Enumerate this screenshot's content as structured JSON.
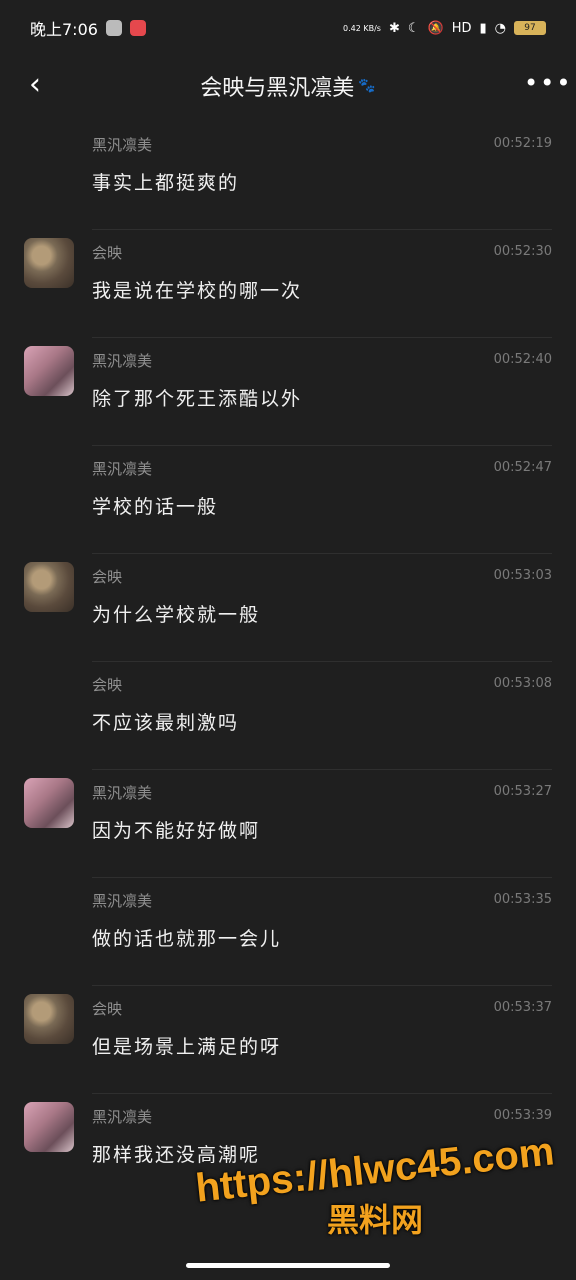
{
  "status": {
    "time": "晚上7:06",
    "net_speed": "0.42\nKB/s",
    "network": "HD",
    "battery": "97"
  },
  "header": {
    "title": "会映与黑汎凛美",
    "title_suffix": "🐾"
  },
  "messages": [
    {
      "sender": "黑汎凛美",
      "time": "00:52:19",
      "text": "事实上都挺爽的",
      "avatar": "none"
    },
    {
      "sender": "会映",
      "time": "00:52:30",
      "text": "我是说在学校的哪一次",
      "avatar": "cat"
    },
    {
      "sender": "黑汎凛美",
      "time": "00:52:40",
      "text": "除了那个死王添酷以外",
      "avatar": "pink"
    },
    {
      "sender": "黑汎凛美",
      "time": "00:52:47",
      "text": "学校的话一般",
      "avatar": "none"
    },
    {
      "sender": "会映",
      "time": "00:53:03",
      "text": "为什么学校就一般",
      "avatar": "cat"
    },
    {
      "sender": "会映",
      "time": "00:53:08",
      "text": "不应该最刺激吗",
      "avatar": "none"
    },
    {
      "sender": "黑汎凛美",
      "time": "00:53:27",
      "text": "因为不能好好做啊",
      "avatar": "pink"
    },
    {
      "sender": "黑汎凛美",
      "time": "00:53:35",
      "text": "做的话也就那一会儿",
      "avatar": "none"
    },
    {
      "sender": "会映",
      "time": "00:53:37",
      "text": "但是场景上满足的呀",
      "avatar": "cat"
    },
    {
      "sender": "黑汎凛美",
      "time": "00:53:39",
      "text": "那样我还没高潮呢",
      "avatar": "pink"
    }
  ],
  "watermark": {
    "line1": "https://hlwc45.com",
    "line2": "黑料网"
  }
}
